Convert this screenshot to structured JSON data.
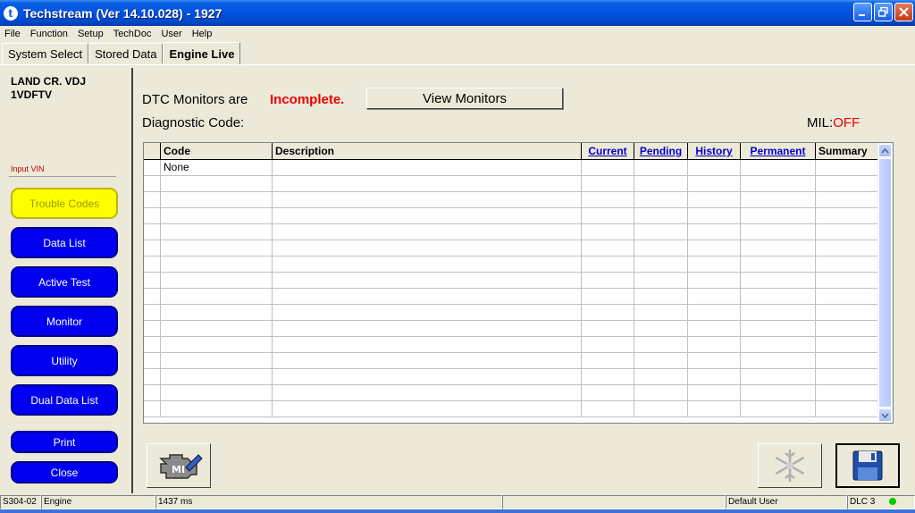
{
  "window": {
    "title": "Techstream (Ver 14.10.028) - 1927"
  },
  "menu": [
    "File",
    "Function",
    "Setup",
    "TechDoc",
    "User",
    "Help"
  ],
  "tabs": [
    {
      "label": "System Select",
      "active": false
    },
    {
      "label": "Stored Data",
      "active": false
    },
    {
      "label": "Engine Live",
      "active": true
    }
  ],
  "vehicle": {
    "model": "LAND CR. VDJ",
    "engine": "1VDFTV"
  },
  "sidebar": {
    "input_vin": "Input VIN",
    "buttons": [
      "Trouble Codes",
      "Data List",
      "Active Test",
      "Monitor",
      "Utility",
      "Dual Data List",
      "Print",
      "Close"
    ]
  },
  "dtc": {
    "monitors_label": "DTC Monitors are",
    "monitors_status": "Incomplete.",
    "view_monitors": "View Monitors",
    "diagnostic_label": "Diagnostic Code:",
    "mil_label": "MIL:",
    "mil_value": "OFF"
  },
  "table": {
    "columns": [
      "Code",
      "Description",
      "Current",
      "Pending",
      "History",
      "Permanent",
      "Summary"
    ],
    "rows": [
      [
        "None",
        "",
        "",
        "",
        "",
        "",
        ""
      ]
    ]
  },
  "statusbar": {
    "code": "S304-02",
    "system": "Engine",
    "time": "1437 ms",
    "user": "Default User",
    "dlc": "DLC 3"
  },
  "colors": {
    "accent": "#0000ee",
    "active_button": "#ffff00",
    "status_red": "#ee0000",
    "titlebar": "#0054e3"
  }
}
